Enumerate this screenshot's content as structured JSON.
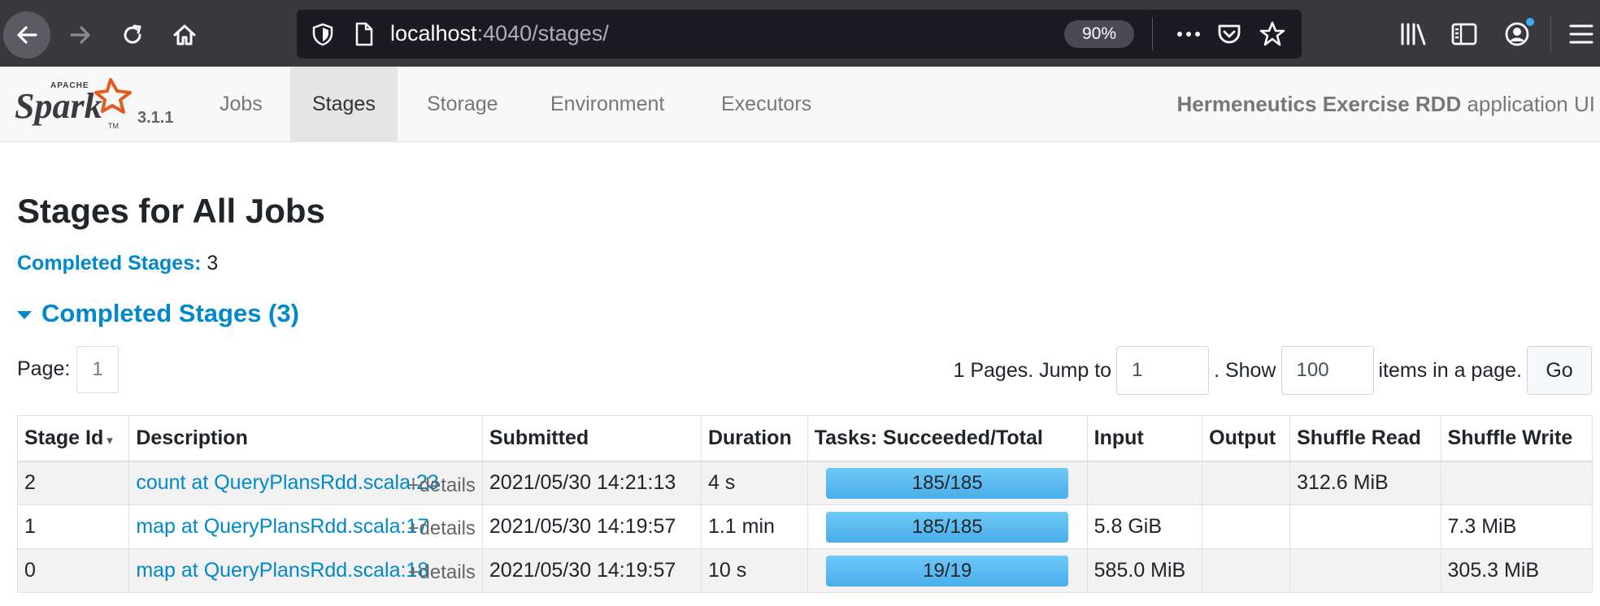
{
  "browser": {
    "url_host": "localhost",
    "url_path": ":4040/stages/",
    "zoom": "90%",
    "icons": [
      "back-arrow-icon",
      "forward-arrow-icon",
      "reload-icon",
      "home-icon",
      "shield-icon",
      "page-icon",
      "more-icon",
      "pocket-icon",
      "star-icon",
      "library-icon",
      "sidebar-icon",
      "account-icon",
      "menu-icon"
    ]
  },
  "navbar": {
    "brand_apache": "APACHE",
    "brand_name": "Spark",
    "version": "3.1.1",
    "items": [
      {
        "label": "Jobs",
        "active": false
      },
      {
        "label": "Stages",
        "active": true
      },
      {
        "label": "Storage",
        "active": false
      },
      {
        "label": "Environment",
        "active": false
      },
      {
        "label": "Executors",
        "active": false
      }
    ],
    "app_name": "Hermeneutics Exercise RDD",
    "app_suffix": " application UI"
  },
  "page": {
    "title": "Stages for All Jobs",
    "summary_label": "Completed Stages:",
    "summary_value": "3",
    "section_title": "Completed Stages (3)",
    "page_label": "Page:",
    "current_page": "1",
    "pager_text1": "1 Pages. Jump to",
    "jump_value": "1",
    "pager_text2": ". Show",
    "show_value": "100",
    "pager_text3": "items in a page.",
    "go_label": "Go"
  },
  "table": {
    "headers": [
      "Stage Id",
      "Description",
      "Submitted",
      "Duration",
      "Tasks: Succeeded/Total",
      "Input",
      "Output",
      "Shuffle Read",
      "Shuffle Write"
    ],
    "sort_indicator": "▾",
    "details_label": "+details",
    "rows": [
      {
        "id": "2",
        "description": "count at QueryPlansRdd.scala:23",
        "submitted": "2021/05/30 14:21:13",
        "duration": "4 s",
        "tasks": "185/185",
        "tasks_fraction": 1.0,
        "input": "",
        "output": "",
        "shuffle_read": "312.6 MiB",
        "shuffle_write": ""
      },
      {
        "id": "1",
        "description": "map at QueryPlansRdd.scala:17",
        "submitted": "2021/05/30 14:19:57",
        "duration": "1.1 min",
        "tasks": "185/185",
        "tasks_fraction": 1.0,
        "input": "5.8 GiB",
        "output": "",
        "shuffle_read": "",
        "shuffle_write": "7.3 MiB"
      },
      {
        "id": "0",
        "description": "map at QueryPlansRdd.scala:18",
        "submitted": "2021/05/30 14:19:57",
        "duration": "10 s",
        "tasks": "19/19",
        "tasks_fraction": 1.0,
        "input": "585.0 MiB",
        "output": "",
        "shuffle_read": "",
        "shuffle_write": "305.3 MiB"
      }
    ]
  },
  "colors": {
    "link": "#0088cc",
    "progress": "#4aaeea",
    "browser_chrome": "#38383d"
  }
}
